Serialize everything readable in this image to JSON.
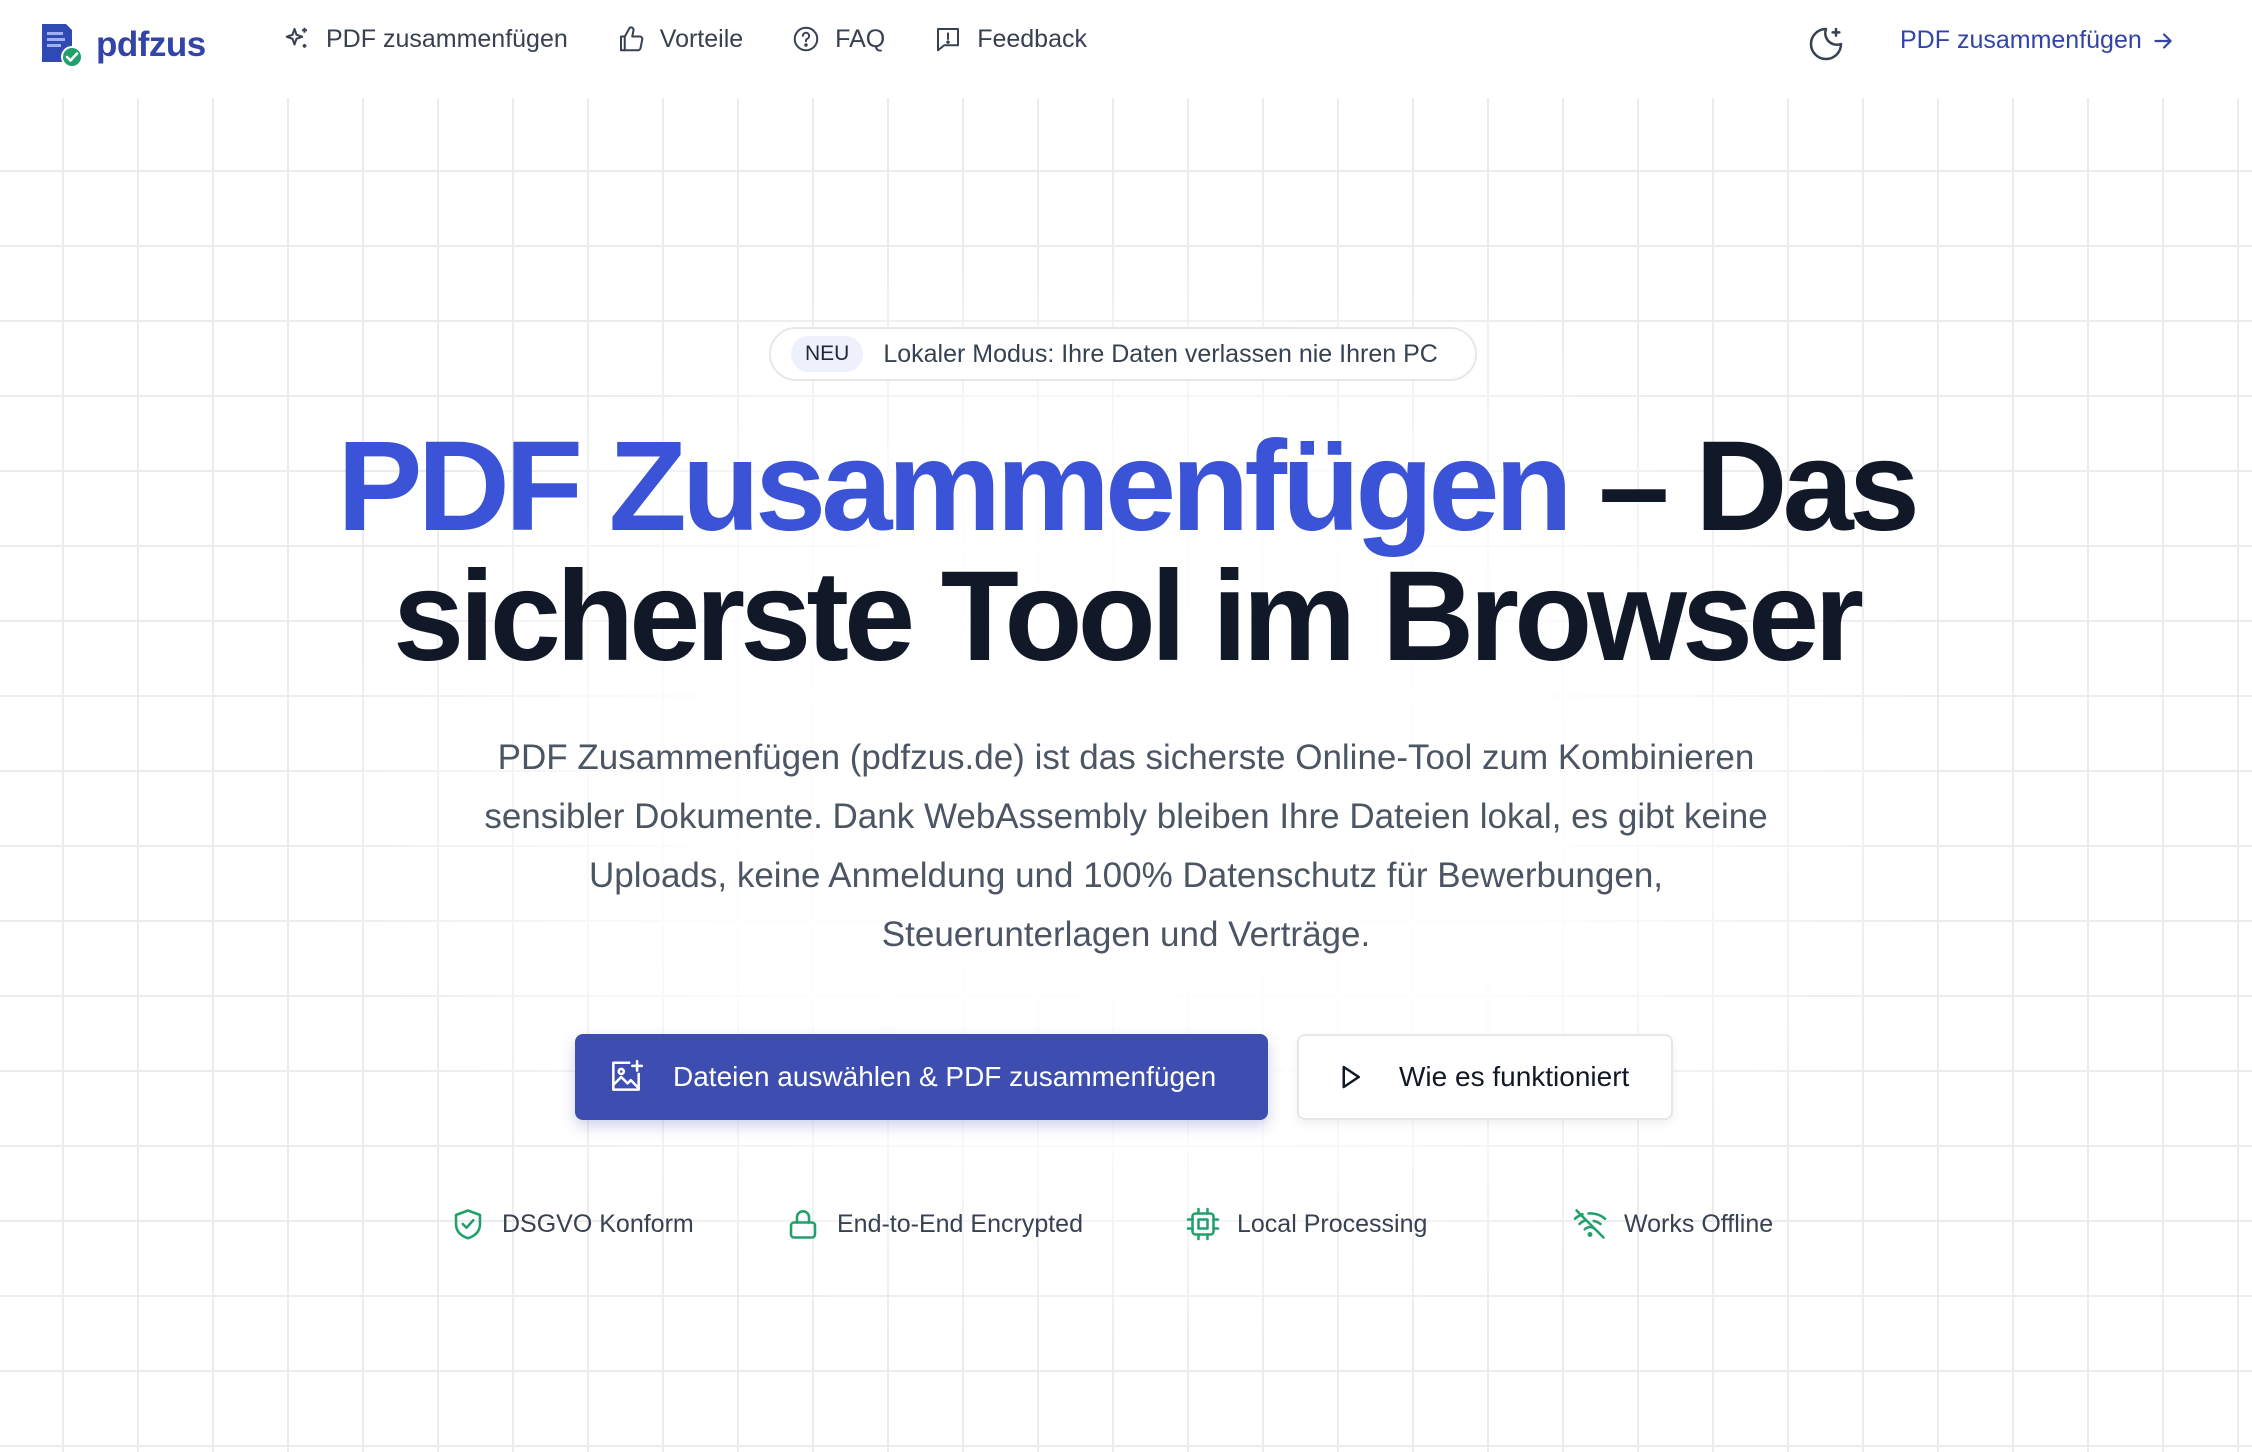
{
  "header": {
    "logo_text": "pdfzus",
    "nav": [
      {
        "label": "PDF zusammenfügen",
        "icon": "sparkles-icon"
      },
      {
        "label": "Vorteile",
        "icon": "thumbs-up-icon"
      },
      {
        "label": "FAQ",
        "icon": "help-circle-icon"
      },
      {
        "label": "Feedback",
        "icon": "message-alert-icon"
      }
    ],
    "theme_icon": "moon-sparkle-icon",
    "cta_label": "PDF zusammenfügen"
  },
  "hero": {
    "badge_tag": "NEU",
    "badge_text": "Lokaler Modus: Ihre Daten verlassen nie Ihren PC",
    "headline_accent": "PDF Zusammenfügen",
    "headline_rest_line1": "– Das",
    "headline_line2": "sicherste Tool im Browser",
    "lead": "PDF Zusammenfügen (pdfzus.de) ist das sicherste Online-Tool zum Kombinieren sensibler Dokumente. Dank WebAssembly bleiben Ihre Dateien lokal, es gibt keine Uploads, keine Anmeldung und 100% Datenschutz für Bewerbungen, Steuerunterlagen und Verträge.",
    "primary_button": "Dateien auswählen & PDF zusammenfügen",
    "secondary_button": "Wie es funktioniert"
  },
  "features": [
    {
      "label": "DSGVO Konform",
      "icon": "shield-check-icon"
    },
    {
      "label": "End-to-End Encrypted",
      "icon": "lock-icon"
    },
    {
      "label": "Local Processing",
      "icon": "cpu-icon"
    },
    {
      "label": "Works Offline",
      "icon": "wifi-off-icon"
    }
  ],
  "colors": {
    "brand": "#3344a8",
    "accent": "#3b53d6",
    "primary_button": "#3d4db0",
    "feature_icon": "#22a06b"
  }
}
